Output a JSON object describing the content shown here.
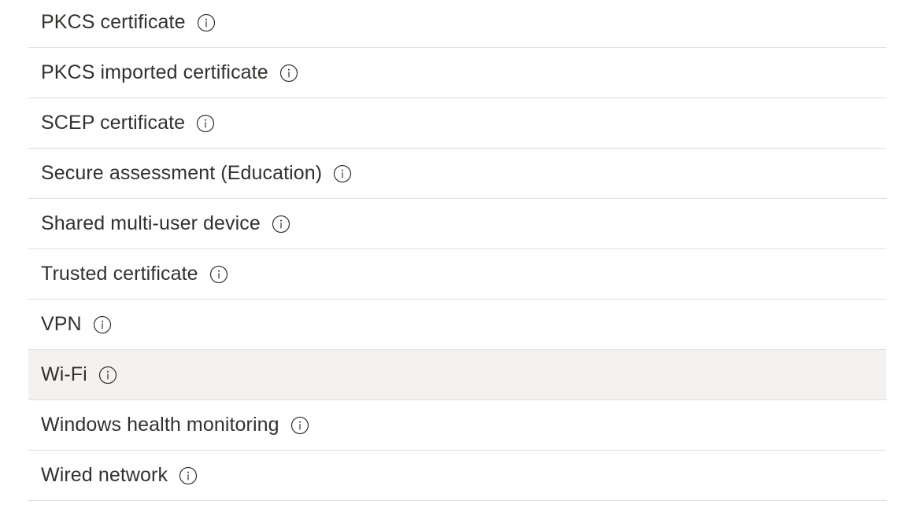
{
  "profile_types": {
    "items": [
      {
        "label": "PKCS certificate",
        "icon": "info-icon",
        "highlighted": false
      },
      {
        "label": "PKCS imported certificate",
        "icon": "info-icon",
        "highlighted": false
      },
      {
        "label": "SCEP certificate",
        "icon": "info-icon",
        "highlighted": false
      },
      {
        "label": "Secure assessment (Education)",
        "icon": "info-icon",
        "highlighted": false
      },
      {
        "label": "Shared multi-user device",
        "icon": "info-icon",
        "highlighted": false
      },
      {
        "label": "Trusted certificate",
        "icon": "info-icon",
        "highlighted": false
      },
      {
        "label": "VPN",
        "icon": "info-icon",
        "highlighted": false
      },
      {
        "label": "Wi-Fi",
        "icon": "info-icon",
        "highlighted": true
      },
      {
        "label": "Windows health monitoring",
        "icon": "info-icon",
        "highlighted": false
      },
      {
        "label": "Wired network",
        "icon": "info-icon",
        "highlighted": false
      }
    ]
  },
  "colors": {
    "text": "#323130",
    "divider": "#e1dfdd",
    "hover_background": "#f3f2f1"
  }
}
